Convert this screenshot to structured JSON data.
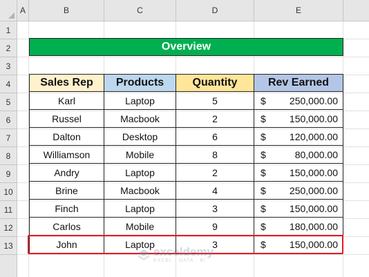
{
  "columns": [
    "A",
    "B",
    "C",
    "D",
    "E"
  ],
  "rows": [
    "1",
    "2",
    "3",
    "4",
    "5",
    "6",
    "7",
    "8",
    "9",
    "10",
    "11",
    "12",
    "13"
  ],
  "overview_title": "Overview",
  "table": {
    "headers": [
      "Sales Rep",
      "Products",
      "Quantity",
      "Rev Earned"
    ],
    "header_colors": [
      "#fff2cc",
      "#bdd7ee",
      "#ffe699",
      "#b4c6e7"
    ],
    "currency": "$",
    "records": [
      {
        "rep": "Karl",
        "product": "Laptop",
        "qty": "5",
        "rev": "250,000.00"
      },
      {
        "rep": "Russel",
        "product": "Macbook",
        "qty": "2",
        "rev": "150,000.00"
      },
      {
        "rep": "Dalton",
        "product": "Desktop",
        "qty": "6",
        "rev": "120,000.00"
      },
      {
        "rep": "Williamson",
        "product": "Mobile",
        "qty": "8",
        "rev": "80,000.00"
      },
      {
        "rep": "Andry",
        "product": "Laptop",
        "qty": "2",
        "rev": "150,000.00"
      },
      {
        "rep": "Brine",
        "product": "Macbook",
        "qty": "4",
        "rev": "250,000.00"
      },
      {
        "rep": "Finch",
        "product": "Laptop",
        "qty": "3",
        "rev": "150,000.00"
      },
      {
        "rep": "Carlos",
        "product": "Mobile",
        "qty": "9",
        "rev": "180,000.00"
      },
      {
        "rep": "John",
        "product": "Laptop",
        "qty": "3",
        "rev": "150,000.00"
      }
    ]
  },
  "highlight_color": "#e31b23",
  "watermark": {
    "brand": "exceldemy",
    "tagline": "EXCEL · DATA · BI"
  }
}
